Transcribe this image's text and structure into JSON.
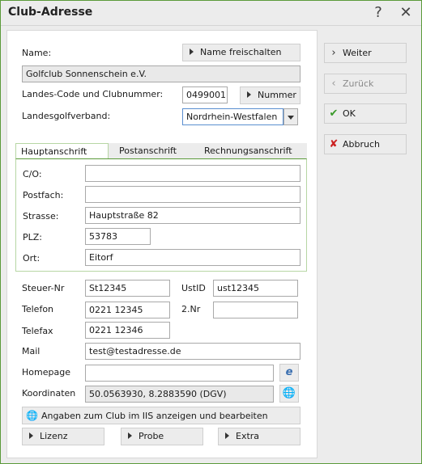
{
  "window": {
    "title": "Club-Adresse",
    "help_glyph": "?",
    "close_glyph": "✕"
  },
  "club": {
    "name_label": "Name:",
    "name_value": "Golfclub Sonnenschein e.V.",
    "unlock_name_label": "Name freischalten",
    "code_label": "Landes-Code und Clubnummer:",
    "code_value": "0499001",
    "number_button_label": "Nummer",
    "association_label": "Landesgolfverband:",
    "association_value": "Nordrhein-Westfalen"
  },
  "tabs": [
    {
      "label": "Hauptanschrift",
      "active": true
    },
    {
      "label": "Postanschrift",
      "active": false
    },
    {
      "label": "Rechnungsanschrift",
      "active": false
    }
  ],
  "address": {
    "co_label": "C/O:",
    "co_value": "",
    "pobox_label": "Postfach:",
    "pobox_value": "",
    "street_label": "Strasse:",
    "street_value": "Hauptstraße 82",
    "zip_label": "PLZ:",
    "zip_value": "53783",
    "city_label": "Ort:",
    "city_value": "Eitorf"
  },
  "contact": {
    "tax_label": "Steuer-Nr",
    "tax_value": "St12345",
    "vat_label": "UstID",
    "vat_value": "ust12345",
    "phone_label": "Telefon",
    "phone_value": "0221 12345",
    "phone2_label": "2.Nr",
    "phone2_value": "",
    "fax_label": "Telefax",
    "fax_value": "0221 12346",
    "mail_label": "Mail",
    "mail_value": "test@testadresse.de",
    "homepage_label": "Homepage",
    "homepage_value": "",
    "coords_label": "Koordinaten",
    "coords_value": "50.0563930, 8.2883590 (DGV)"
  },
  "actions": {
    "iis_label": "Angaben zum Club im IIS anzeigen und bearbeiten",
    "license_label": "Lizenz",
    "sample_label": "Probe",
    "extra_label": "Extra"
  },
  "side_buttons": {
    "next_label": "Weiter",
    "back_label": "Zurück",
    "ok_label": "OK",
    "cancel_label": "Abbruch"
  },
  "colors": {
    "accent_green": "#5b9a3a",
    "ok_check": "#3a9a2a",
    "cancel_x": "#cc2222"
  }
}
